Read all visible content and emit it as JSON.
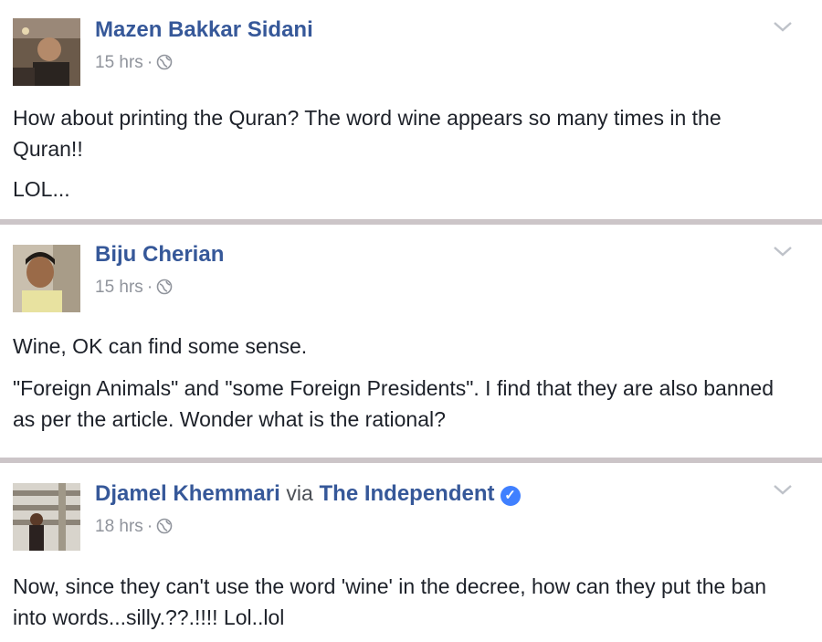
{
  "comments": [
    {
      "author": "Mazen Bakkar Sidani",
      "time": "15 hrs",
      "paragraphs": [
        "How about printing the Quran? The word wine appears so many times in the Quran!!",
        "LOL..."
      ]
    },
    {
      "author": "Biju Cherian",
      "time": "15 hrs",
      "paragraphs": [
        "Wine, OK can find some sense.",
        "\"Foreign Animals\" and \"some Foreign Presidents\". I find that they are also banned as per the article. Wonder what is the rational?"
      ]
    },
    {
      "author": "Djamel Khemmari",
      "via": "via",
      "page": "The Independent",
      "time": "18 hrs",
      "paragraphs": [
        "Now, since they can't use the word 'wine' in the decree, how can they put the ban into words...silly.??.!!!! Lol..lol"
      ]
    }
  ],
  "separator": "·",
  "icons": {
    "privacy": "globe-icon",
    "menu": "chevron-down-icon",
    "verified": "verified-badge-icon"
  },
  "colors": {
    "name": "#365899",
    "meta": "#90949c",
    "divider": "#ccc5c8",
    "verified": "#4080ff"
  }
}
